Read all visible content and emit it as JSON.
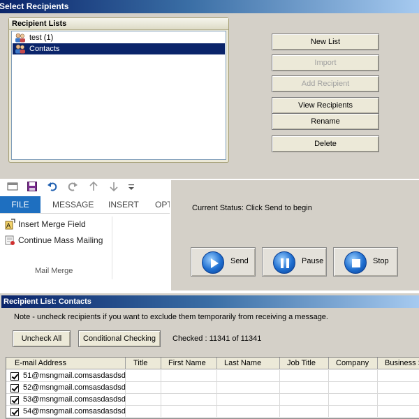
{
  "select_dialog": {
    "title": "Select Recipients",
    "group_label": "Recipient Lists",
    "lists": [
      {
        "label": "test (1)",
        "selected": false
      },
      {
        "label": "Contacts",
        "selected": true
      }
    ],
    "buttons": {
      "new_list": "New List",
      "import": "Import",
      "add_recipient": "Add Recipient",
      "view_recipients": "View Recipients",
      "rename": "Rename",
      "delete": "Delete"
    }
  },
  "ribbon": {
    "tabs": [
      "FILE",
      "MESSAGE",
      "INSERT",
      "OPT"
    ],
    "items": {
      "insert_merge_field": "Insert Merge Field",
      "continue_mass_mailing": "Continue Mass Mailing"
    },
    "group_label": "Mail Merge"
  },
  "status_panel": {
    "status_text": "Current Status: Click Send to begin",
    "send": "Send",
    "pause": "Pause",
    "stop": "Stop"
  },
  "recipient_list": {
    "title": "Recipient List: Contacts",
    "note": "Note - uncheck recipients if you want to exclude them temporarily from receiving a message.",
    "uncheck_all": "Uncheck All",
    "conditional_checking": "Conditional Checking",
    "checked_count": "Checked : 11341 of 11341",
    "columns": [
      "E-mail Address",
      "Title",
      "First Name",
      "Last Name",
      "Job Title",
      "Company",
      "Business S"
    ],
    "rows": [
      {
        "email": "51@msngmail.comsasdasdsd",
        "checked": true
      },
      {
        "email": "52@msngmail.comsasdasdsd",
        "checked": true
      },
      {
        "email": "53@msngmail.comsasdasdsd",
        "checked": true
      },
      {
        "email": "54@msngmail.comsasdasdsd",
        "checked": true
      }
    ]
  },
  "colors": {
    "title_bar": "#0a246a",
    "file_tab": "#1e6fc0",
    "selection": "#0a246a",
    "dialog_bg": "#d4d0c8"
  }
}
